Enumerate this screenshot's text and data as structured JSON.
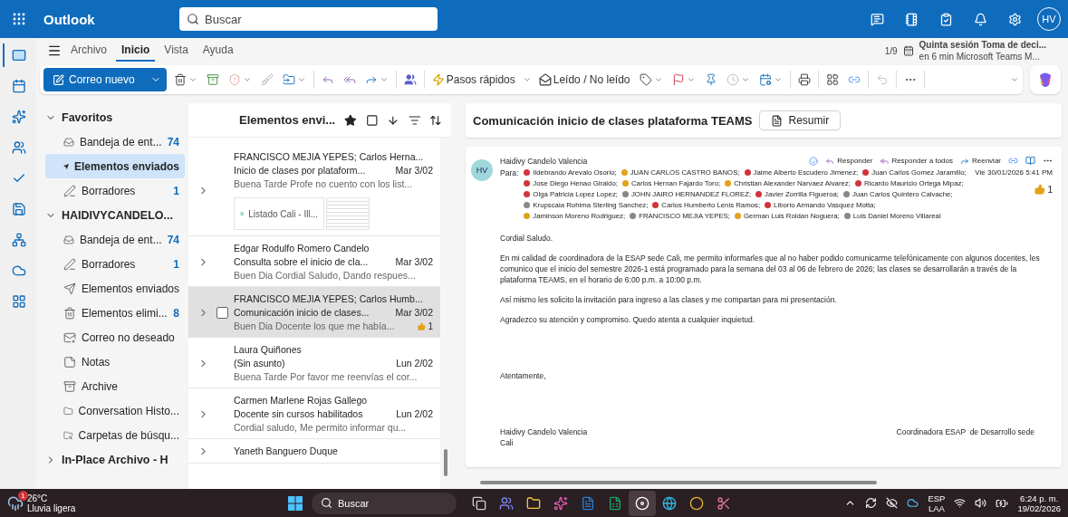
{
  "app": {
    "name": "Outlook",
    "search_placeholder": "Buscar",
    "avatar": "HV"
  },
  "rail": [
    {
      "kind": "mail",
      "selected": true
    },
    {
      "kind": "calendar",
      "selected": false
    },
    {
      "kind": "copilot",
      "selected": false
    },
    {
      "kind": "people",
      "selected": false
    },
    {
      "kind": "todo",
      "selected": false
    },
    {
      "kind": "files",
      "selected": false
    },
    {
      "kind": "org",
      "selected": false
    },
    {
      "kind": "cloud",
      "selected": false
    },
    {
      "kind": "apps",
      "selected": false
    }
  ],
  "ribbon": {
    "tabs": [
      {
        "label": "Archivo",
        "selected": false
      },
      {
        "label": "Inicio",
        "selected": true
      },
      {
        "label": "Vista",
        "selected": false
      },
      {
        "label": "Ayuda",
        "selected": false
      }
    ],
    "new_mail": "Correo nuevo",
    "quick_steps": "Pasos rápidos",
    "read_unread": "Leído / No leído"
  },
  "reminder": {
    "counter": "1/9",
    "title": "Quinta sesión Toma de deci...",
    "detail": "en 6 min Microsoft Teams M..."
  },
  "folders": [
    {
      "title": "Favoritos",
      "expanded": true,
      "items": [
        {
          "kind": "inbox",
          "label": "Bandeja de ent...",
          "count": "74",
          "selected": false
        },
        {
          "kind": "sent",
          "label": "Elementos enviados",
          "selected": true
        },
        {
          "kind": "drafts",
          "label": "Borradores",
          "count": "1",
          "selected": false
        }
      ]
    },
    {
      "title": "HAIDIVYCANDELO...",
      "expanded": true,
      "items": [
        {
          "kind": "inbox",
          "label": "Bandeja de ent...",
          "count": "74",
          "selected": false
        },
        {
          "kind": "drafts",
          "label": "Borradores",
          "count": "1",
          "selected": false
        },
        {
          "kind": "sent",
          "label": "Elementos enviados",
          "selected": false
        },
        {
          "kind": "deleted",
          "label": "Elementos elimi...",
          "count": "8",
          "selected": false
        },
        {
          "kind": "junk",
          "label": "Correo no deseado",
          "selected": false
        },
        {
          "kind": "notes",
          "label": "Notas",
          "selected": false
        },
        {
          "kind": "archive",
          "label": "Archive",
          "selected": false
        },
        {
          "kind": "folder",
          "label": "Conversation Histo...",
          "selected": false
        },
        {
          "kind": "search",
          "label": "Carpetas de búsqu...",
          "selected": false
        }
      ]
    },
    {
      "title": "In-Place Archivo - H",
      "expanded": false
    }
  ],
  "list": {
    "title": "Elementos envi...",
    "messages": [
      {
        "sender": "FRANCISCO MEJIA YEPES; Carlos Herna...",
        "subject": "Inicio de clases por plataform...",
        "date": "Mar 3/02",
        "preview": "Buena Tarde Profe no cuento con los list...",
        "attachment": "Listado Cali - Ill...",
        "selected": false
      },
      {
        "sender": "Edgar Rodulfo Romero Candelo",
        "subject": "Consulta sobre el inicio de cla...",
        "date": "Mar 3/02",
        "preview": "Buen Dia Cordial Saludo, Dando respues...",
        "selected": false
      },
      {
        "sender": "FRANCISCO MEJIA YEPES; Carlos Humb...",
        "subject": "Comunicación inicio de clases...",
        "date": "Mar 3/02",
        "preview": "Buen Dia Docente los que me había...",
        "reaction": "1",
        "selected": true
      },
      {
        "sender": "Laura Quiñones",
        "subject": "(Sin asunto)",
        "date": "Lun 2/02",
        "preview": "Buena Tarde Por favor me reenvías el cor...",
        "selected": false
      },
      {
        "sender": "Carmen Marlene Rojas Gallego",
        "subject": "Docente sin cursos habilitados",
        "date": "Lun 2/02",
        "preview": "Cordial saludo, Me permito informar qu...",
        "selected": false
      },
      {
        "sender": "Yaneth Banguero Duque",
        "selected": false
      }
    ]
  },
  "reading": {
    "subject": "Comunicación inicio de clases plataforma TEAMS",
    "summarize": "Resumir",
    "message": {
      "avatar": "HV",
      "sender": "Haidivy Candelo Valencia",
      "actions": [
        {
          "kind": "reply",
          "label": "Responder"
        },
        {
          "kind": "reply_all",
          "label": "Responder a todos"
        },
        {
          "kind": "forward",
          "label": "Reenviar"
        }
      ],
      "to_label": "Para:",
      "date": "Vie 30/01/2026 5:41 PM",
      "reaction": "1",
      "recipients": [
        {
          "name": "Ildebrando Arevalo Osorio;",
          "color": "#d13438"
        },
        {
          "name": "JUAN CARLOS CASTRO BANOS;",
          "color": "#e3a21a"
        },
        {
          "name": "Jaime Alberto Escudero Jimenez;",
          "color": "#d13438"
        },
        {
          "name": "Juan Carlos Gomez Jaramillo;",
          "color": "#d13438"
        },
        {
          "name": "Jose Diego Henao Giraldo;",
          "color": "#d13438"
        },
        {
          "name": "Carlos Hernan Fajardo Toro;",
          "color": "#e3a21a"
        },
        {
          "name": "Christian Alexander Narvaez Alvarez;",
          "color": "#e3a21a"
        },
        {
          "name": "Ricardo Mauricio Ortega Mipaz;",
          "color": "#d13438"
        },
        {
          "name": "Olga Patricia Lopez Lopez;",
          "color": "#d13438"
        },
        {
          "name": "JOHN JAIRO HERNANDEZ FLOREZ;",
          "color": "#8a8886"
        },
        {
          "name": "Javier Zorrilla Figueroa;",
          "color": "#d13438"
        },
        {
          "name": "Juan Carlos Quintero Calvache;",
          "color": "#8a8886"
        },
        {
          "name": "Krupscaia Rohima Sterling Sanchez;",
          "color": "#8a8886"
        },
        {
          "name": "Carlos Humberto Lenis Ramos;",
          "color": "#d13438"
        },
        {
          "name": "Liborio Armando Vasquez Motta;",
          "color": "#d13438"
        },
        {
          "name": "Jaminson Moreno Rodriguez;",
          "color": "#e3a21a"
        },
        {
          "name": "FRANCISCO MEJIA YEPES;",
          "color": "#8a8886"
        },
        {
          "name": "German Luis Roldan Noguera;",
          "color": "#e3a21a"
        },
        {
          "name": "Luis Daniel Moreno Villareal",
          "color": "#8a8886"
        }
      ],
      "body": [
        "Cordial Saludo.",
        "En mi calidad de coordinadora de la ESAP sede Cali, me permito informarles que al no haber podido comunicarme telefónicamente con algunos docentes, les comunico que el inicio del semestre 2026-1 está programado para la semana del 03 al 06 de febrero de 2026; las clases se desarrollarán a través de la plataforma TEAMS, en el horario de 6:00 p.m. a 10:00 p.m.",
        "Así mismo les solicito la invitación para ingreso a las clases y me compartan para mi presentación.",
        "Agradezco su atención y compromiso. Quedo atenta a cualquier inquietud."
      ],
      "closing": "Atentamente,",
      "signature_name": "Haidivy Candelo Valencia",
      "signature_title": "Coordinadora ESAP  de Desarrollo sede",
      "signature_city": "Cali"
    }
  },
  "taskbar": {
    "weather_badge": "1",
    "temperature": "26°C",
    "condition": "Lluvia ligera",
    "search_placeholder": "Buscar",
    "apps": [
      {
        "kind": "taskview",
        "active": false
      },
      {
        "kind": "teams",
        "active": false
      },
      {
        "kind": "explorer",
        "active": false
      },
      {
        "kind": "copilot",
        "active": false
      },
      {
        "kind": "word",
        "active": false
      },
      {
        "kind": "excel",
        "active": false
      },
      {
        "kind": "recorder",
        "active": true
      },
      {
        "kind": "browser",
        "active": false
      },
      {
        "kind": "chrome",
        "active": false
      },
      {
        "kind": "snip",
        "active": false
      }
    ],
    "language": "ESP",
    "layout": "LAA",
    "time": "6:24 p. m.",
    "date": "19/02/2026"
  }
}
